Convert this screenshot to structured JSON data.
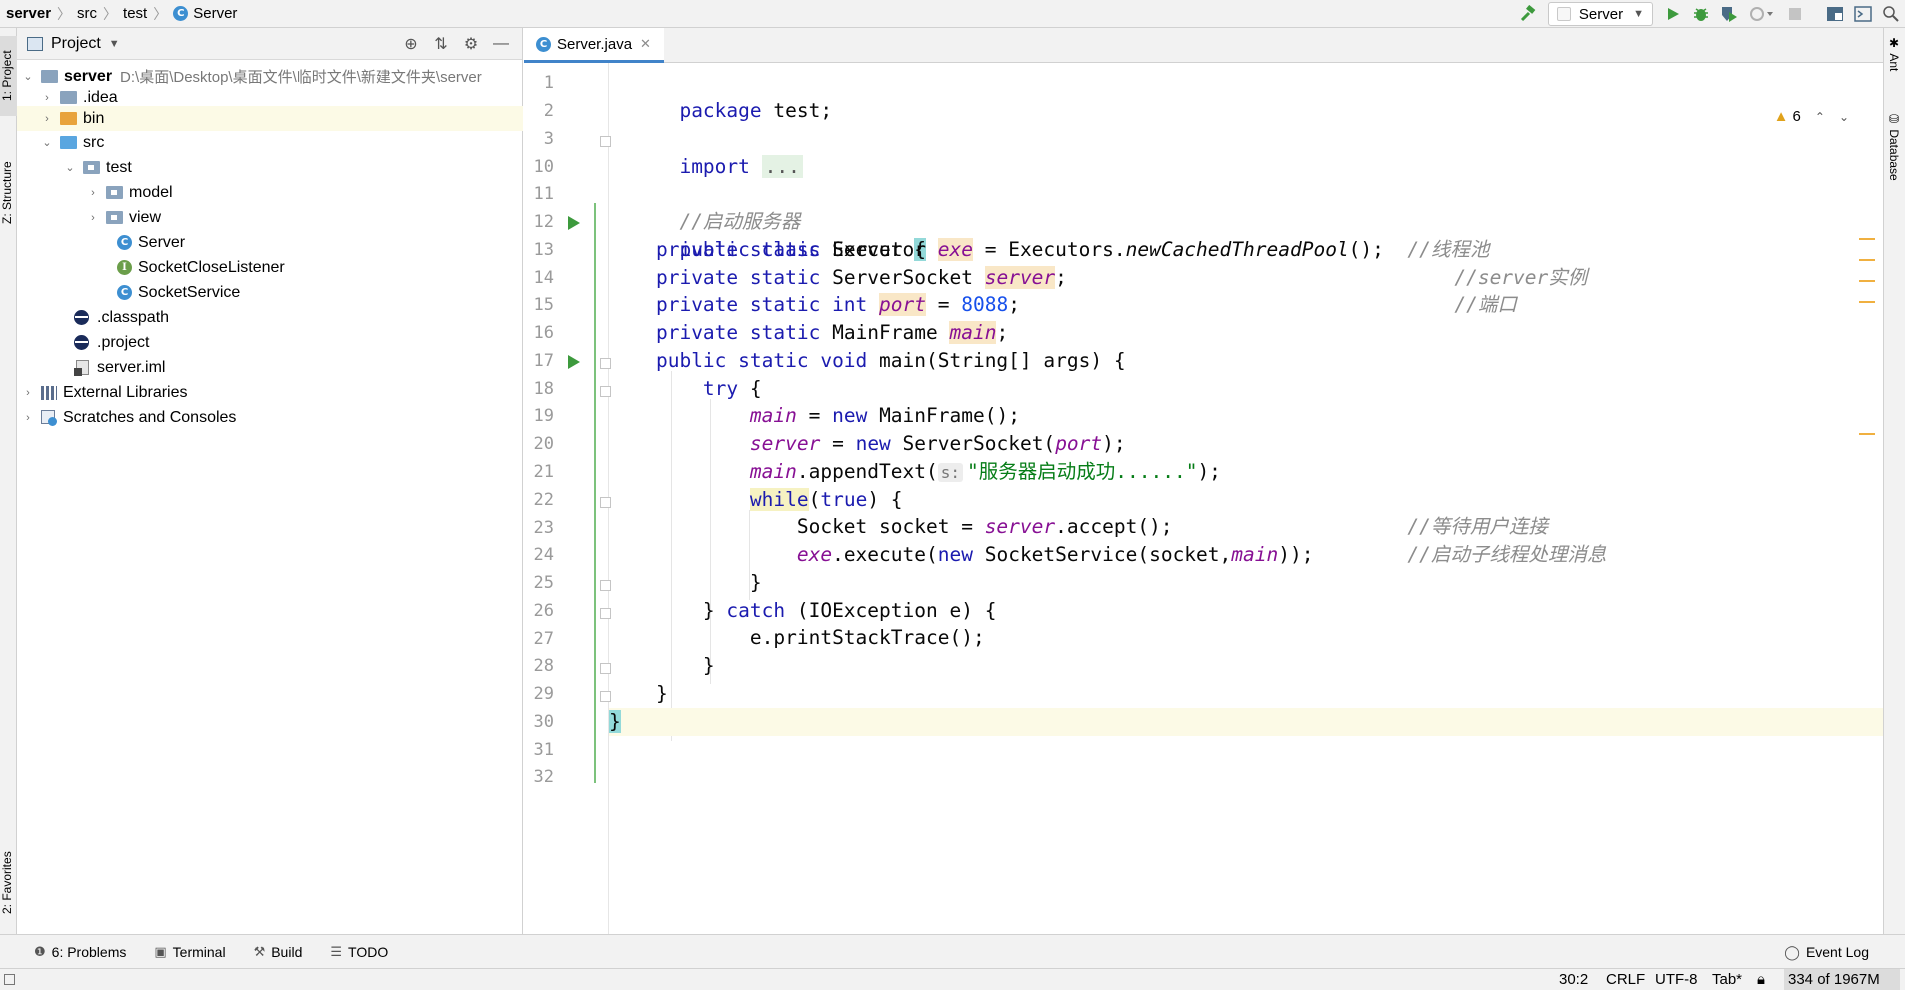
{
  "breadcrumb": {
    "items": [
      "server",
      "src",
      "test",
      "Server"
    ]
  },
  "toolbar": {
    "run_config": "Server"
  },
  "left_strip": {
    "project_tab": "1: Project",
    "structure_tab": "Z: Structure",
    "favorites_tab": "2: Favorites"
  },
  "right_strip": {
    "ant_tab": "Ant",
    "database_tab": "Database"
  },
  "project_panel": {
    "title": "Project",
    "tree": [
      {
        "label": "server",
        "path": "D:\\桌面\\Desktop\\桌面文件\\临时文件\\新建文件夹\\server"
      },
      {
        "label": ".idea"
      },
      {
        "label": "bin"
      },
      {
        "label": "src"
      },
      {
        "label": "test"
      },
      {
        "label": "model"
      },
      {
        "label": "view"
      },
      {
        "label": "Server"
      },
      {
        "label": "SocketCloseListener"
      },
      {
        "label": "SocketService"
      },
      {
        "label": ".classpath"
      },
      {
        "label": ".project"
      },
      {
        "label": "server.iml"
      },
      {
        "label": "External Libraries"
      },
      {
        "label": "Scratches and Consoles"
      }
    ]
  },
  "editor": {
    "tab_label": "Server.java",
    "warnings_count": "6",
    "line_numbers": [
      "1",
      "2",
      "3",
      "10",
      "11",
      "12",
      "13",
      "14",
      "15",
      "16",
      "17",
      "18",
      "19",
      "20",
      "21",
      "22",
      "23",
      "24",
      "25",
      "26",
      "27",
      "28",
      "29",
      "30",
      "31",
      "32"
    ],
    "code": {
      "l1_kw": "package",
      "l1_rest": " test;",
      "l3_kw": "import",
      "l3_fold": "...",
      "l11_cmt": "//启动服务器",
      "l12_kw": "public class",
      "l12_name": " Server ",
      "l12_brace": "{",
      "l13_kw": "private static",
      "l13_type": " Executor ",
      "l13_fld": "exe",
      "l13_eq": " = Executors.",
      "l13_mth": "newCachedThreadPool",
      "l13_end": "();  ",
      "l13_cmt": "//线程池",
      "l14_kw": "private static",
      "l14_type": " ServerSocket ",
      "l14_fld": "server",
      "l14_end": ";",
      "l14_cmt": "//server实例",
      "l15_kw": "private static int",
      "l15_sp": " ",
      "l15_fld": "port",
      "l15_eq": " = ",
      "l15_num": "8088",
      "l15_end": ";",
      "l15_cmt": "//端口",
      "l16_kw": "private static",
      "l16_type": " MainFrame ",
      "l16_fld": "main",
      "l16_end": ";",
      "l17_kw": "public static void",
      "l17_rest": " main(String[] args) {",
      "l18_kw": "try",
      "l18_rest": " {",
      "l19_fld": "main",
      "l19_eq": " = ",
      "l19_kw": "new",
      "l19_rest": " MainFrame();",
      "l20_fld": "server",
      "l20_eq": " = ",
      "l20_kw": "new",
      "l20_rest": " ServerSocket(",
      "l20_fld2": "port",
      "l20_end": ");",
      "l21_fld": "main",
      "l21_call": ".appendText(",
      "l21_hint": "s:",
      "l21_str": "\"服务器启动成功......\"",
      "l21_end": ");",
      "l22_kw": "while",
      "l22_open": "(",
      "l22_kw2": "true",
      "l22_end": ") {",
      "l23_text": "Socket socket = ",
      "l23_fld": "server",
      "l23_end": ".accept();",
      "l23_cmt": "//等待用户连接",
      "l24_fld": "exe",
      "l24_call": ".execute(",
      "l24_kw": "new",
      "l24_mid": " SocketService(socket,",
      "l24_fld2": "main",
      "l24_end": "));",
      "l24_cmt": "//启动子线程处理消息",
      "l25_text": "}",
      "l26_open": "} ",
      "l26_kw": "catch",
      "l26_rest": " (IOException e) {",
      "l27_text": "e.printStackTrace();",
      "l28_text": "}",
      "l29_text": "}",
      "l30_text": "}"
    }
  },
  "bottom_tools": {
    "problems": "6: Problems",
    "terminal": "Terminal",
    "build": "Build",
    "todo": "TODO",
    "event_log": "Event Log"
  },
  "status_bar": {
    "position": "30:2",
    "line_sep": "CRLF",
    "encoding": "UTF-8",
    "indent": "Tab*",
    "memory": "334 of 1967M"
  }
}
